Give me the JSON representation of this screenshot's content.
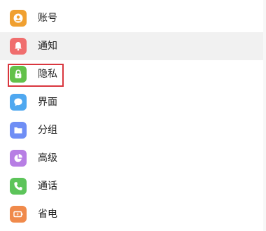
{
  "menu": {
    "items": [
      {
        "label": "账号",
        "icon": "account-icon",
        "color": "#f0a030"
      },
      {
        "label": "通知",
        "icon": "bell-icon",
        "color": "#f06e6e"
      },
      {
        "label": "隐私",
        "icon": "lock-icon",
        "color": "#63c14a"
      },
      {
        "label": "界面",
        "icon": "chat-bubble-icon",
        "color": "#4fa8f0"
      },
      {
        "label": "分组",
        "icon": "folder-icon",
        "color": "#6f8ef5"
      },
      {
        "label": "高级",
        "icon": "pie-chart-icon",
        "color": "#b77ee4"
      },
      {
        "label": "通话",
        "icon": "phone-icon",
        "color": "#5cc45a"
      },
      {
        "label": "省电",
        "icon": "battery-icon",
        "color": "#f08a4b"
      }
    ]
  },
  "highlight": {
    "target": "隐私",
    "color": "#d9363e"
  }
}
